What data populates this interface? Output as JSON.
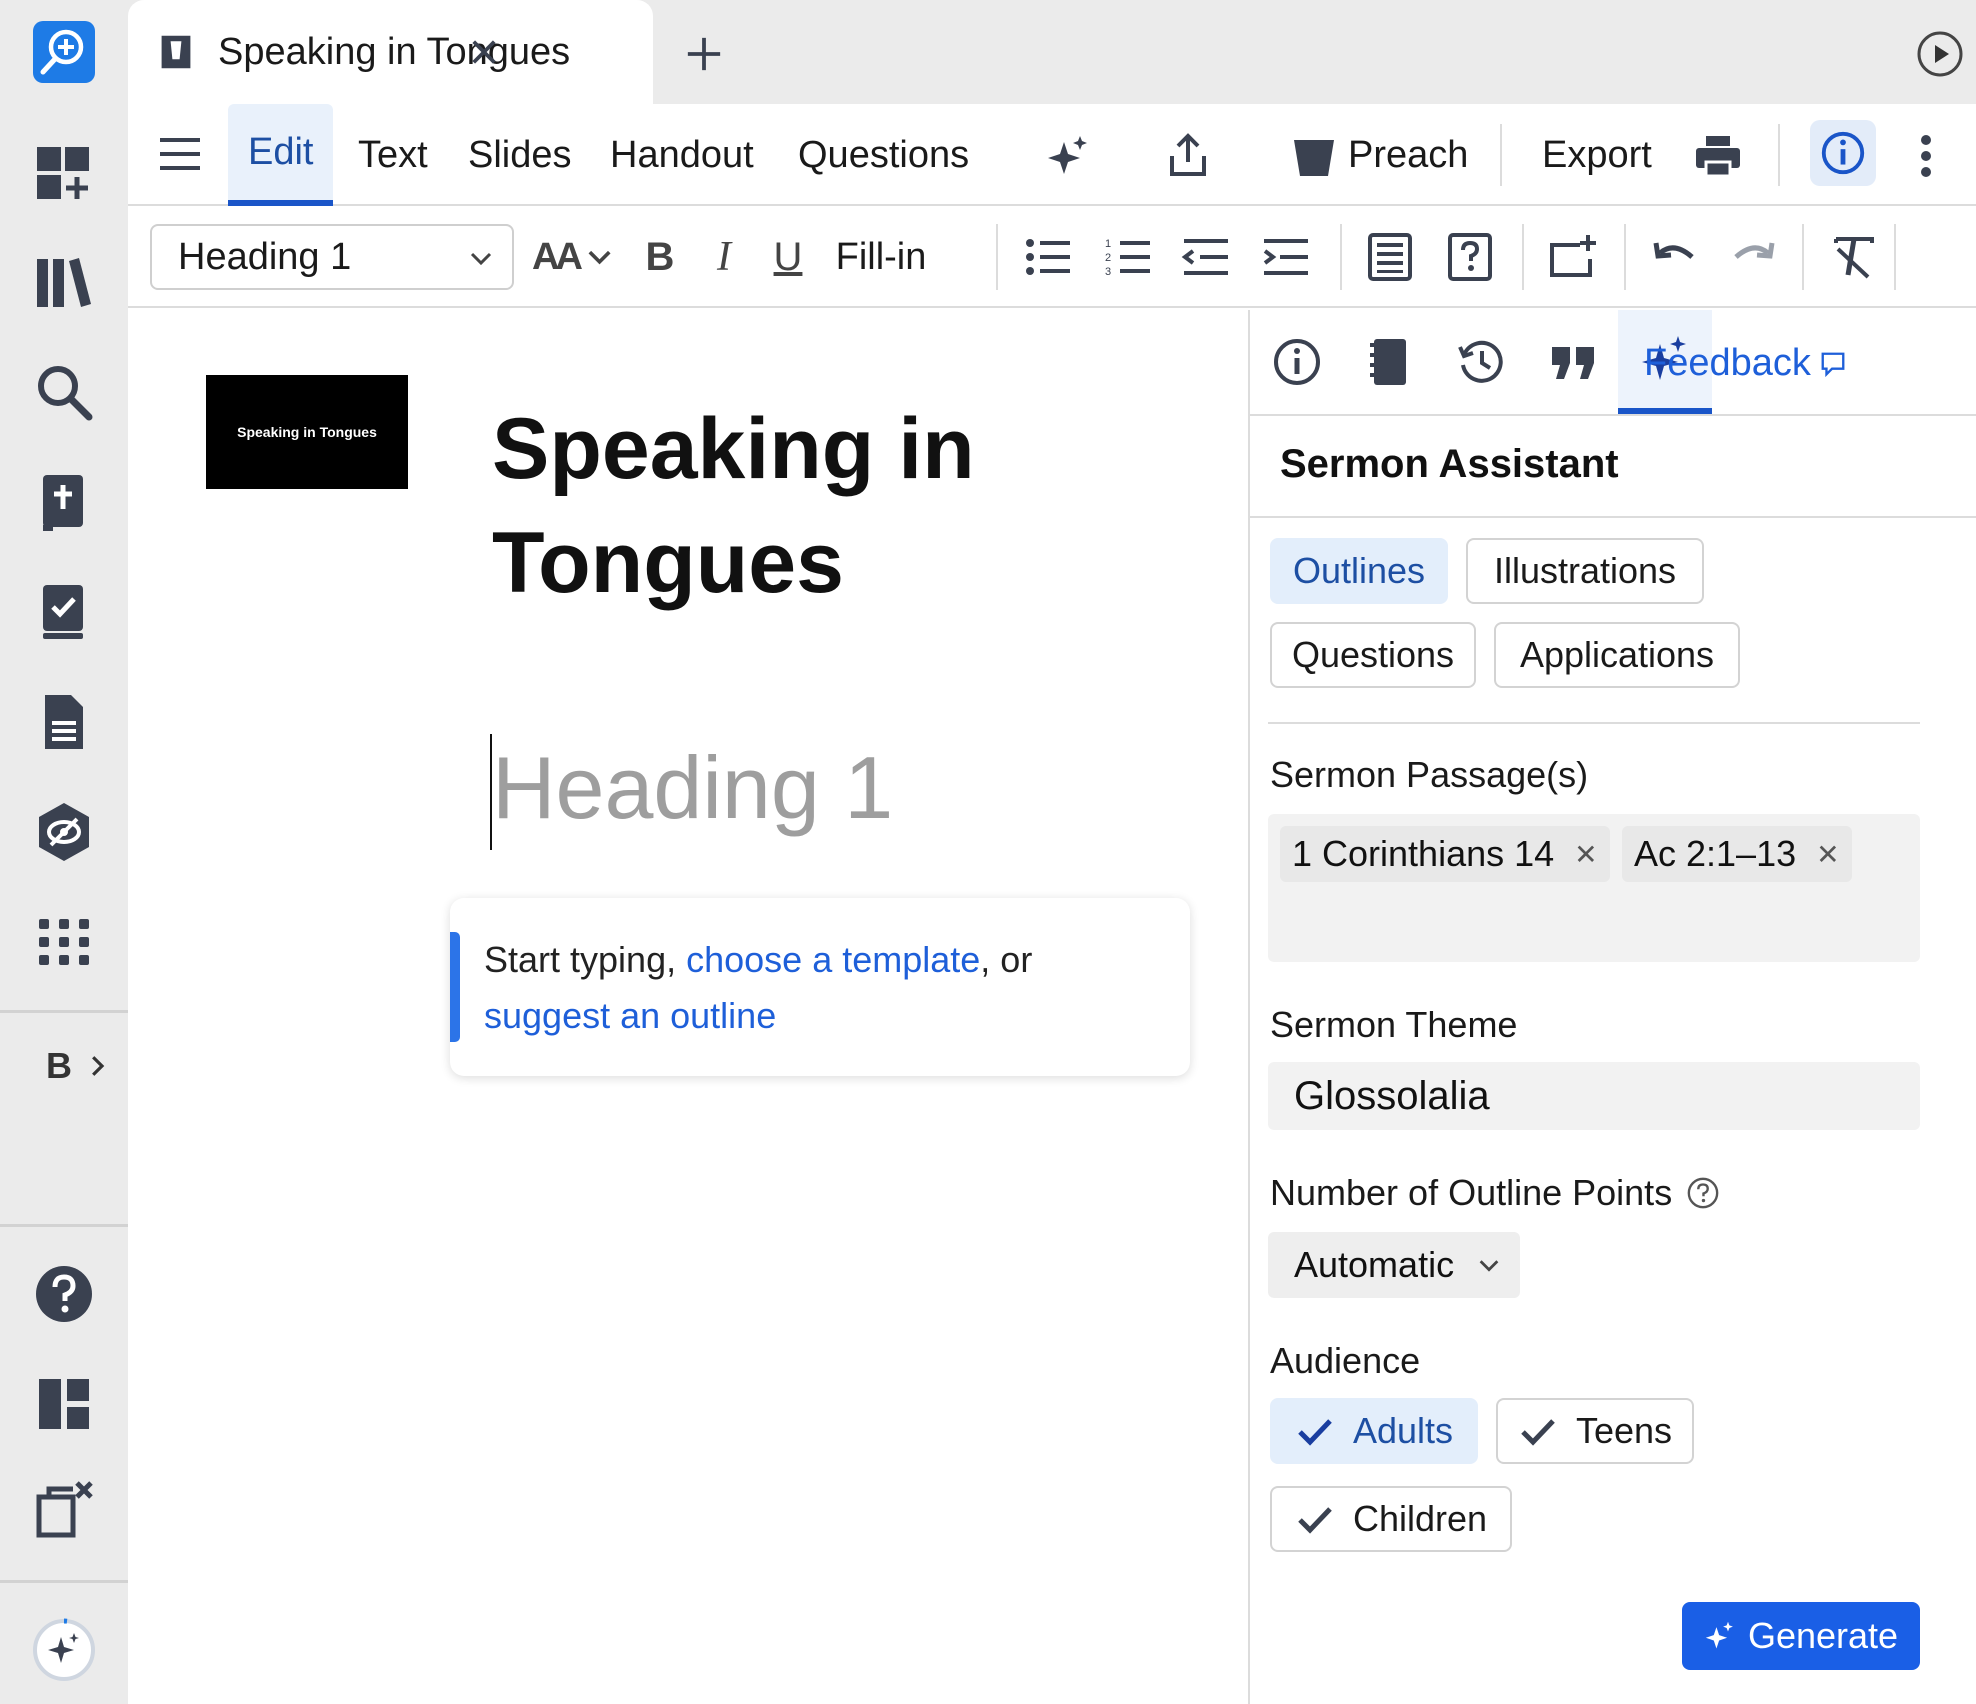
{
  "tab": {
    "title": "Speaking in Tongues"
  },
  "menu": {
    "items": [
      "Edit",
      "Text",
      "Slides",
      "Handout",
      "Questions"
    ],
    "preach_label": "Preach",
    "export_label": "Export"
  },
  "format": {
    "style_value": "Heading 1",
    "fill_in_label": "Fill-in",
    "bold_label": "B",
    "italic_label": "I",
    "underline_label": "U",
    "font_size_label": "AA"
  },
  "editor": {
    "thumbnail_text": "Speaking in Tongues",
    "title": "Speaking in Tongues",
    "heading_placeholder": "Heading 1",
    "hint": {
      "prefix": "Start typing, ",
      "template_link": "choose a template",
      "middle": ", or ",
      "outline_link": "suggest an outline"
    }
  },
  "panel": {
    "title": "Sermon Assistant",
    "feedback_label": "Feedback",
    "categories": [
      "Outlines",
      "Illustrations",
      "Questions",
      "Applications"
    ],
    "selected_category": "Outlines",
    "passage_label": "Sermon Passage(s)",
    "passages": [
      "1 Corinthians 14",
      "Ac 2:1–13"
    ],
    "theme_label": "Sermon Theme",
    "theme_value": "Glossolalia",
    "points_label": "Number of Outline Points",
    "points_value": "Automatic",
    "audience_label": "Audience",
    "audience": [
      "Adults",
      "Teens",
      "Children"
    ],
    "selected_audience": "Adults",
    "generate_label": "Generate"
  },
  "rail": {
    "profile_label": "B"
  },
  "colors": {
    "accent": "#1a55c8",
    "link": "#1e5fd9",
    "primary_button": "#1a5fe6",
    "selected_chip_bg": "#e3eefb",
    "rail_icon": "#3a4150"
  },
  "icons": {
    "rail": [
      "logos-search-plus-icon",
      "add-panel-icon",
      "library-icon",
      "search-icon",
      "bible-icon",
      "checklist-icon",
      "document-icon",
      "hexagon-eye-icon",
      "apps-grid-icon",
      "help-icon",
      "layout-icon",
      "close-panels-icon",
      "assistant-sparkle-icon"
    ],
    "panel_tabs": [
      "info-icon",
      "book-icon",
      "history-icon",
      "quote-icon",
      "sparkle-icon"
    ]
  }
}
